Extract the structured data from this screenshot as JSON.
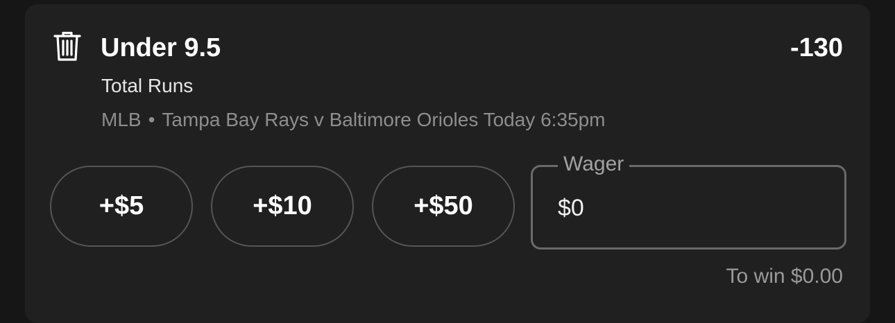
{
  "bet": {
    "selection": "Under 9.5",
    "odds": "-130",
    "market": "Total Runs",
    "league": "MLB",
    "separator": "•",
    "matchup": "Tampa Bay Rays v Baltimore Orioles Today 6:35pm"
  },
  "icons": {
    "remove": "trash-icon"
  },
  "quick_add": [
    {
      "label": "+$5"
    },
    {
      "label": "+$10"
    },
    {
      "label": "+$50"
    }
  ],
  "wager": {
    "label": "Wager",
    "value": "$0"
  },
  "to_win": "To win $0.00",
  "colors": {
    "background": "#161616",
    "card": "#202020",
    "text_primary": "#ffffff",
    "text_secondary": "#8e8e8e",
    "border": "#555555"
  }
}
